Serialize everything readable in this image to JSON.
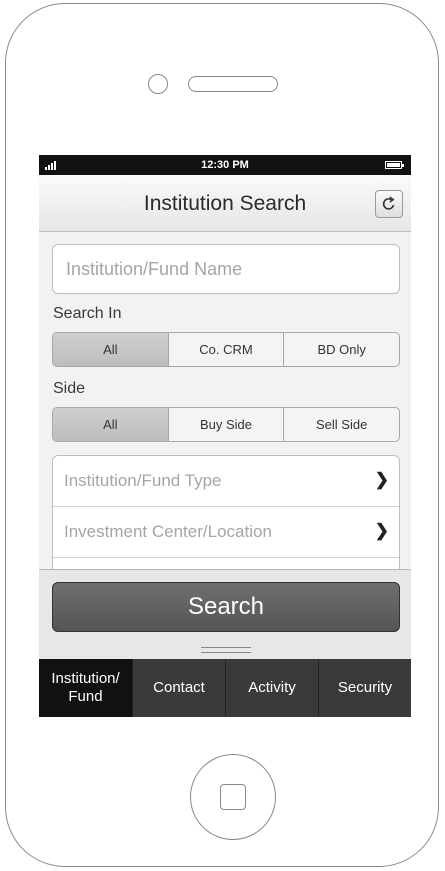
{
  "status_bar": {
    "time": "12:30 PM"
  },
  "header": {
    "title": "Institution Search",
    "refresh_icon": "refresh-icon"
  },
  "search": {
    "name_placeholder": "Institution/Fund Name",
    "value": ""
  },
  "search_in": {
    "label": "Search In",
    "options": [
      "All",
      "Co. CRM",
      "BD Only"
    ],
    "selected": "All"
  },
  "side": {
    "label": "Side",
    "options": [
      "All",
      "Buy Side",
      "Sell Side"
    ],
    "selected": "All"
  },
  "filters": [
    {
      "label": "Institution/Fund Type",
      "icon": "chevron-right-icon"
    },
    {
      "label": "Investment Center/Location",
      "icon": "chevron-right-icon"
    }
  ],
  "actions": {
    "search_label": "Search"
  },
  "tabs": [
    {
      "label": "Institution/\nFund",
      "active": true
    },
    {
      "label": "Contact",
      "active": false
    },
    {
      "label": "Activity",
      "active": false
    },
    {
      "label": "Security",
      "active": false
    }
  ],
  "colors": {
    "tab_active": "#111111",
    "tab_bar": "#3a3a3a",
    "search_button": "#606060"
  }
}
